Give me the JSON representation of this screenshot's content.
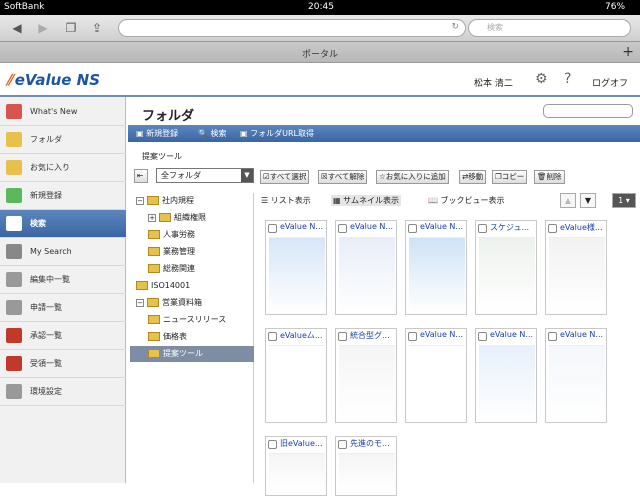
{
  "status": {
    "carrier": "SoftBank",
    "time": "20:45",
    "battery": "76%"
  },
  "browser": {
    "search_placeholder": "検索",
    "tab_title": "ポータル",
    "tab_add": "+"
  },
  "header": {
    "logo": "eValue NS",
    "user": "松本 清二",
    "gear_icon": "gear-icon",
    "help": "?",
    "logout": "ログオフ"
  },
  "sidebar": {
    "items": [
      {
        "label": "What's New",
        "icon": "whats-new-icon",
        "color": "#d9534f"
      },
      {
        "label": "フォルダ",
        "icon": "folder-icon",
        "color": "#e8c04c"
      },
      {
        "label": "お気に入り",
        "icon": "favorites-folder-icon",
        "color": "#e8c04c"
      },
      {
        "label": "新規登録",
        "icon": "new-register-icon",
        "color": "#5cb85c"
      },
      {
        "label": "検索",
        "icon": "search-icon",
        "color": "#ffffff"
      },
      {
        "label": "My Search",
        "icon": "my-search-icon",
        "color": "#888888"
      },
      {
        "label": "編集中一覧",
        "icon": "editing-icon",
        "color": "#999999"
      },
      {
        "label": "申請一覧",
        "icon": "application-icon",
        "color": "#999999"
      },
      {
        "label": "承認一覧",
        "icon": "approval-icon",
        "color": "#c0392b"
      },
      {
        "label": "受領一覧",
        "icon": "received-icon",
        "color": "#c0392b"
      },
      {
        "label": "環境設定",
        "icon": "settings-icon",
        "color": "#999999"
      }
    ]
  },
  "main": {
    "title": "フォルダ",
    "toolbar": [
      "新規登録",
      "検索",
      "フォルダURL取得"
    ],
    "subtitle": "提案ツール",
    "folder_select": "全フォルダ",
    "actions": [
      "すべて選択",
      "すべて解除",
      "お気に入りに追加",
      "移動",
      "コピー",
      "削除"
    ],
    "views": [
      "リスト表示",
      "サムネイル表示",
      "ブックビュー表示"
    ],
    "page": "1",
    "tree": [
      {
        "label": "社内規程",
        "level": 0,
        "box": "−"
      },
      {
        "label": "組織権限",
        "level": 1,
        "box": "+"
      },
      {
        "label": "人事労務",
        "level": 1,
        "box": ""
      },
      {
        "label": "業務管理",
        "level": 1,
        "box": ""
      },
      {
        "label": "総務関連",
        "level": 1,
        "box": ""
      },
      {
        "label": "ISO14001",
        "level": 0,
        "box": ""
      },
      {
        "label": "営業資料箱",
        "level": 0,
        "box": "−"
      },
      {
        "label": "ニュースリリース",
        "level": 1,
        "box": ""
      },
      {
        "label": "価格表",
        "level": 1,
        "box": ""
      },
      {
        "label": "提案ツール",
        "level": 1,
        "box": "",
        "selected": true
      }
    ],
    "cards": [
      {
        "title": "eValue N..."
      },
      {
        "title": "eValue N..."
      },
      {
        "title": "eValue N..."
      },
      {
        "title": "スケジュ..."
      },
      {
        "title": "eValue様..."
      },
      {
        "title": "eValue厶..."
      },
      {
        "title": "統合型グ..."
      },
      {
        "title": "eValue N..."
      },
      {
        "title": "eValue N..."
      },
      {
        "title": "eValue N..."
      },
      {
        "title": "旧eValue..."
      },
      {
        "title": "先進のモ..."
      }
    ]
  }
}
